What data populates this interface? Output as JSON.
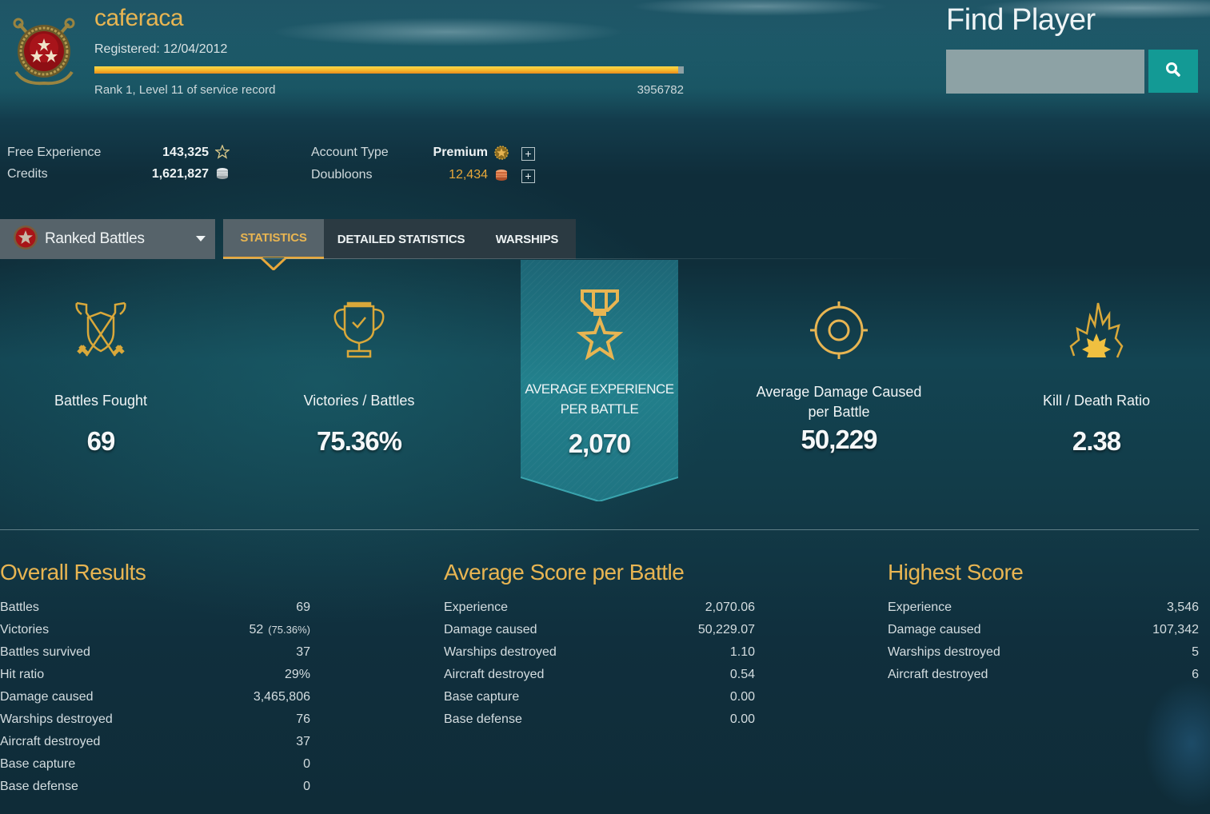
{
  "header": {
    "username": "caferaca",
    "registered": "Registered: 12/04/2012",
    "service_record_progress": 0.99,
    "rank_text": "Rank 1,  Level 11 of service record",
    "service_record_xp": "3956782"
  },
  "find_player": {
    "title": "Find Player",
    "input_value": "",
    "input_placeholder": "",
    "search_icon": "search-icon"
  },
  "account": {
    "free_experience_label": "Free Experience",
    "free_experience_value": "143,325",
    "free_experience_icon": "star-icon",
    "credits_label": "Credits",
    "credits_value": "1,621,827",
    "credits_icon": "silver-coins-icon",
    "account_type_label": "Account Type",
    "account_type_value": "Premium",
    "account_type_icon": "premium-badge-icon",
    "doubloons_label": "Doubloons",
    "doubloons_value": "12,434",
    "doubloons_icon": "doubloons-icon",
    "plus_label": "+"
  },
  "colors": {
    "accent_gold": "#e8b552",
    "doubloons": "#e8a83a",
    "search_button": "#139a95",
    "banner": "#1f7f8c"
  },
  "mode_selector": {
    "selected": "Ranked Battles",
    "icon": "ranked-star-icon"
  },
  "tabs": [
    {
      "label": "STATISTICS",
      "active": true
    },
    {
      "label": "DETAILED STATISTICS",
      "active": false
    },
    {
      "label": "WARSHIPS",
      "active": false
    }
  ],
  "highlights": [
    {
      "icon": "crossed-swords-shield-icon",
      "label": "Battles Fought",
      "value": "69"
    },
    {
      "icon": "trophy-icon",
      "label": "Victories / Battles",
      "value": "75.36%"
    },
    {
      "icon": "medal-star-icon",
      "label": "AVERAGE EXPERIENCE PER BATTLE",
      "value": "2,070"
    },
    {
      "icon": "crosshair-icon",
      "label": "Average Damage Caused per Battle",
      "value": "50,229"
    },
    {
      "icon": "explosion-icon",
      "label": "Kill / Death Ratio",
      "value": "2.38"
    }
  ],
  "overall_results": {
    "title": "Overall Results",
    "rows": [
      {
        "label": "Battles",
        "value": "69"
      },
      {
        "label": "Victories",
        "value": "52",
        "extra": "(75.36%)"
      },
      {
        "label": "Battles survived",
        "value": "37"
      },
      {
        "label": "Hit ratio",
        "value": "29%"
      },
      {
        "label": "Damage caused",
        "value": "3,465,806"
      },
      {
        "label": "Warships destroyed",
        "value": "76"
      },
      {
        "label": "Aircraft destroyed",
        "value": "37"
      },
      {
        "label": "Base capture",
        "value": "0"
      },
      {
        "label": "Base defense",
        "value": "0"
      }
    ]
  },
  "average_score": {
    "title": "Average Score per Battle",
    "rows": [
      {
        "label": "Experience",
        "value": "2,070.06"
      },
      {
        "label": "Damage caused",
        "value": "50,229.07"
      },
      {
        "label": "Warships destroyed",
        "value": "1.10"
      },
      {
        "label": "Aircraft destroyed",
        "value": "0.54"
      },
      {
        "label": "Base capture",
        "value": "0.00"
      },
      {
        "label": "Base defense",
        "value": "0.00"
      }
    ]
  },
  "highest_score": {
    "title": "Highest Score",
    "rows": [
      {
        "label": "Experience",
        "value": "3,546"
      },
      {
        "label": "Damage caused",
        "value": "107,342"
      },
      {
        "label": "Warships destroyed",
        "value": "5"
      },
      {
        "label": "Aircraft destroyed",
        "value": "6"
      }
    ]
  }
}
